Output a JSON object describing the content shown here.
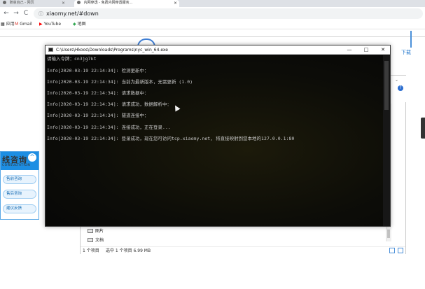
{
  "browser": {
    "tabs": [
      {
        "label": "随意自己 - 网页",
        "close": "×"
      },
      {
        "label": "内网穿透 - 免费内网穿透服务...",
        "close": "×"
      }
    ],
    "url": "xiaomy.net/#down",
    "bookmarks": [
      {
        "label": "应用",
        "icon": "apps-icon"
      },
      {
        "label": "Gmail",
        "icon": "gmail-icon"
      },
      {
        "label": "YouTube",
        "icon": "youtube-icon"
      },
      {
        "label": "地图",
        "icon": "map-icon"
      }
    ],
    "nav": {
      "back": "←",
      "forward": "→",
      "reload": "C"
    }
  },
  "webpage": {
    "download_label": "下载",
    "consult": {
      "title": "线咨询",
      "subtitle": "CONSULTATION",
      "close": "^",
      "items": [
        "售前咨询",
        "售后咨询",
        "建议反馈"
      ]
    }
  },
  "explorer": {
    "folders": [
      "图片",
      "文档"
    ],
    "status_count": "1 个项目",
    "status_selected": "选中 1 个项目  6.99 MB"
  },
  "terminal": {
    "title": "C:\\Users\\Hkoos\\Downloads\\Programs\\nyc_win_64.exe",
    "controls": {
      "minimize": "—",
      "maximize": "□",
      "close": "✕"
    },
    "lines": [
      "请输入令牌：cn3jg7kt",
      "Info[2020-03-19 22:14:34]: 检测更新中：",
      "Info[2020-03-19 22:14:34]: 当前为最新版本，无需更新 (1.0)",
      "Info[2020-03-19 22:14:34]: 请求数据中：",
      "Info[2020-03-19 22:14:34]: 请求成功，数据解析中：",
      "Info[2020-03-19 22:14:34]: 隧道连接中：",
      "Info[2020-03-19 22:14:34]: 连接成功，正在登录...",
      "Info[2020-03-19 22:14:34]: 登录成功，现在您可访问tcp.xiaomy.net, 将直接映射到您本地的127.0.0.1:80"
    ]
  }
}
